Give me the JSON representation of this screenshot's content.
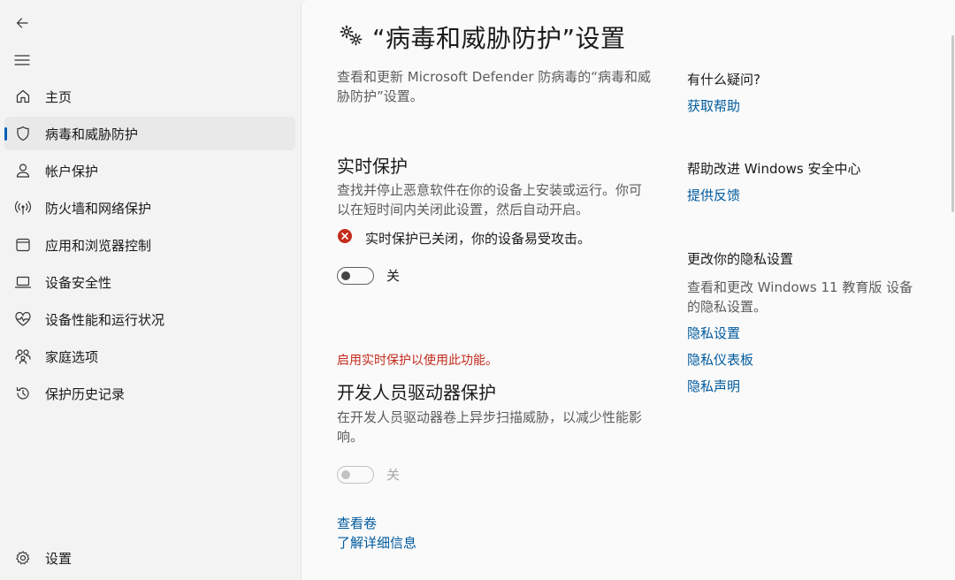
{
  "sidebar": {
    "items": [
      {
        "label": "主页"
      },
      {
        "label": "病毒和威胁防护"
      },
      {
        "label": "帐户保护"
      },
      {
        "label": "防火墙和网络保护"
      },
      {
        "label": "应用和浏览器控制"
      },
      {
        "label": "设备安全性"
      },
      {
        "label": "设备性能和运行状况"
      },
      {
        "label": "家庭选项"
      },
      {
        "label": "保护历史记录"
      }
    ],
    "active_index": 1,
    "settings_label": "设置"
  },
  "main": {
    "title": "“病毒和威胁防护”设置",
    "description": "查看和更新 Microsoft Defender 防病毒的“病毒和威胁防护”设置。",
    "realtime": {
      "title": "实时保护",
      "description": "查找并停止恶意软件在你的设备上安装或运行。你可以在短时间内关闭此设置，然后自动开启。",
      "alert_text": "实时保护已关闭，你的设备易受攻击。",
      "toggle_label": "关",
      "toggle_on": false
    },
    "warning_text": "启用实时保护以使用此功能。",
    "dev_drive": {
      "title": "开发人员驱动器保护",
      "description": "在开发人员驱动器卷上异步扫描威胁，以减少性能影响。",
      "toggle_label": "关",
      "toggle_on": false,
      "disabled": true,
      "links": [
        "查看卷",
        "了解详细信息"
      ]
    }
  },
  "right": {
    "questions_title": "有什么疑问?",
    "get_help": "获取帮助",
    "improve_title": "帮助改进 Windows 安全中心",
    "feedback": "提供反馈",
    "privacy_title": "更改你的隐私设置",
    "privacy_desc": "查看和更改 Windows 11 教育版 设备的隐私设置。",
    "privacy_links": [
      "隐私设置",
      "隐私仪表板",
      "隐私声明"
    ]
  },
  "colors": {
    "accent": "#005fb8",
    "link": "#005a9e",
    "error": "#c42b1c"
  }
}
